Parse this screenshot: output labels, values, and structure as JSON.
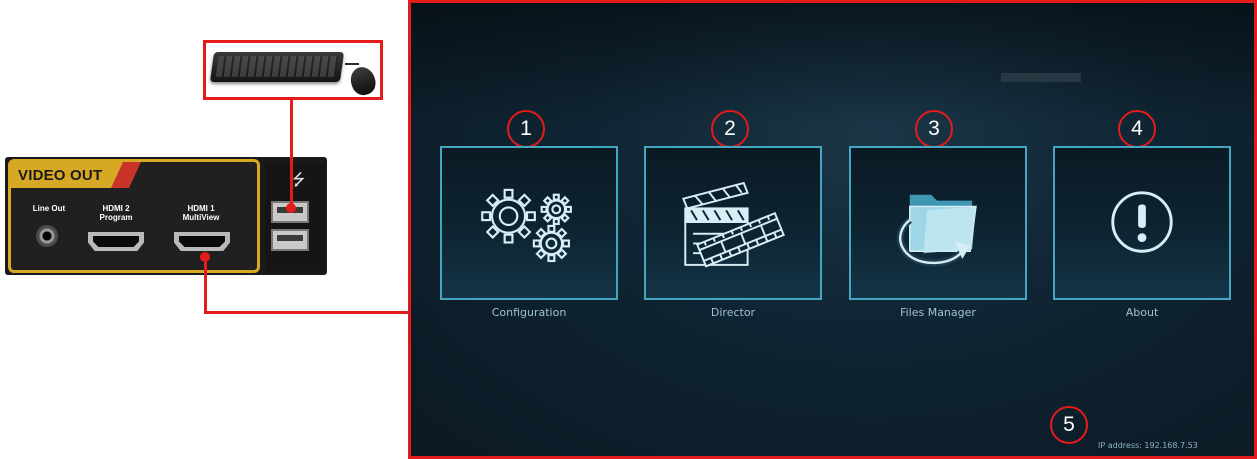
{
  "hardware": {
    "video_out_label": "VIDEO OUT",
    "ports": {
      "line_out": "Line Out",
      "hdmi2_line1": "HDMI 2",
      "hdmi2_line2": "Program",
      "hdmi1_line1": "HDMI 1",
      "hdmi1_line2": "MultiView"
    },
    "usb_symbol": "⭍"
  },
  "menu": {
    "tiles": [
      {
        "number": "1",
        "label": "Configuration",
        "icon": "gears-icon"
      },
      {
        "number": "2",
        "label": "Director",
        "icon": "clapperboard-film-icon"
      },
      {
        "number": "3",
        "label": "Files Manager",
        "icon": "folder-arrow-icon"
      },
      {
        "number": "4",
        "label": "About",
        "icon": "exclamation-circle-icon"
      }
    ],
    "ip_marker_number": "5",
    "ip_address": "IP address: 192.168.7.53"
  },
  "colors": {
    "annotation_red": "#e41b1b",
    "tile_border": "#45a6c2",
    "icon_stroke": "#d8eef6",
    "video_out_yellow": "#d7a823"
  }
}
